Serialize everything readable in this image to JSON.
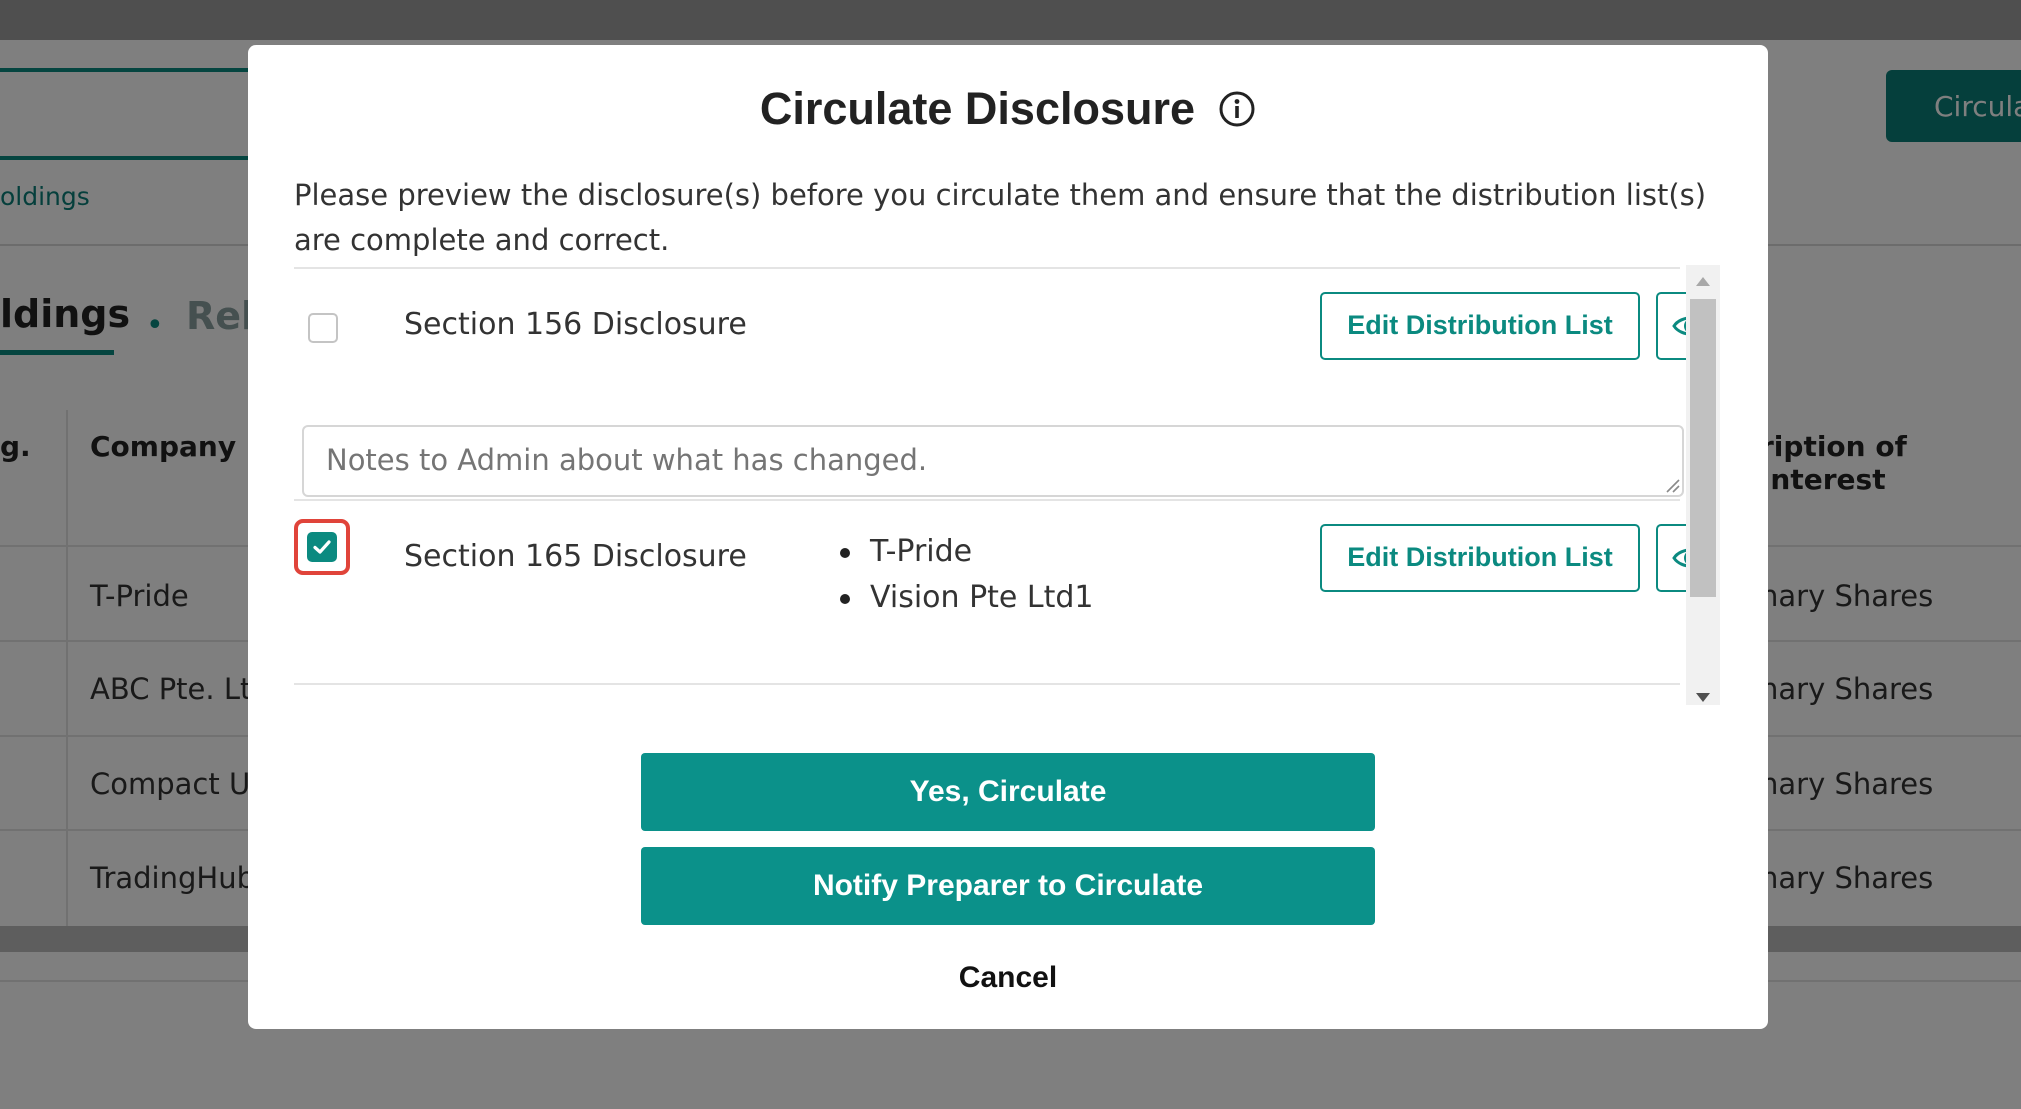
{
  "background": {
    "holdings_link": "oldings",
    "circulate_button": "Circula",
    "tabs": {
      "active": "ldings",
      "inactive": "Rel"
    },
    "table": {
      "headers": [
        "g.",
        "Company N",
        "ription of Interest"
      ],
      "rows": [
        {
          "company": "T-Pride",
          "interest": "nary Shares"
        },
        {
          "company": "ABC Pte. Ltd",
          "interest": "nary Shares"
        },
        {
          "company": "Compact Ul",
          "interest": "nary Shares"
        },
        {
          "company": "TradingHub",
          "interest": "nary Shares"
        }
      ]
    }
  },
  "modal": {
    "title": "Circulate Disclosure",
    "title_icon": "info-icon",
    "description": "Please preview the disclosure(s) before you circulate them and ensure that the distribution list(s) are complete and correct.",
    "disclosures": [
      {
        "label": "Section 156 Disclosure",
        "checked": false,
        "recipients": [],
        "edit_label": "Edit Distribution List",
        "preview_icon": "eye-icon",
        "notes_placeholder": "Notes to Admin about what has changed."
      },
      {
        "label": "Section 165 Disclosure",
        "checked": true,
        "recipients": [
          "T-Pride",
          "Vision Pte Ltd1"
        ],
        "edit_label": "Edit Distribution List",
        "preview_icon": "eye-icon"
      }
    ],
    "primary_button": "Yes, Circulate",
    "secondary_button": "Notify Preparer to Circulate",
    "cancel_label": "Cancel"
  },
  "colors": {
    "accent": "#0b918a",
    "highlight": "#e0443a",
    "overlay": "rgba(0,0,0,0.5)"
  }
}
